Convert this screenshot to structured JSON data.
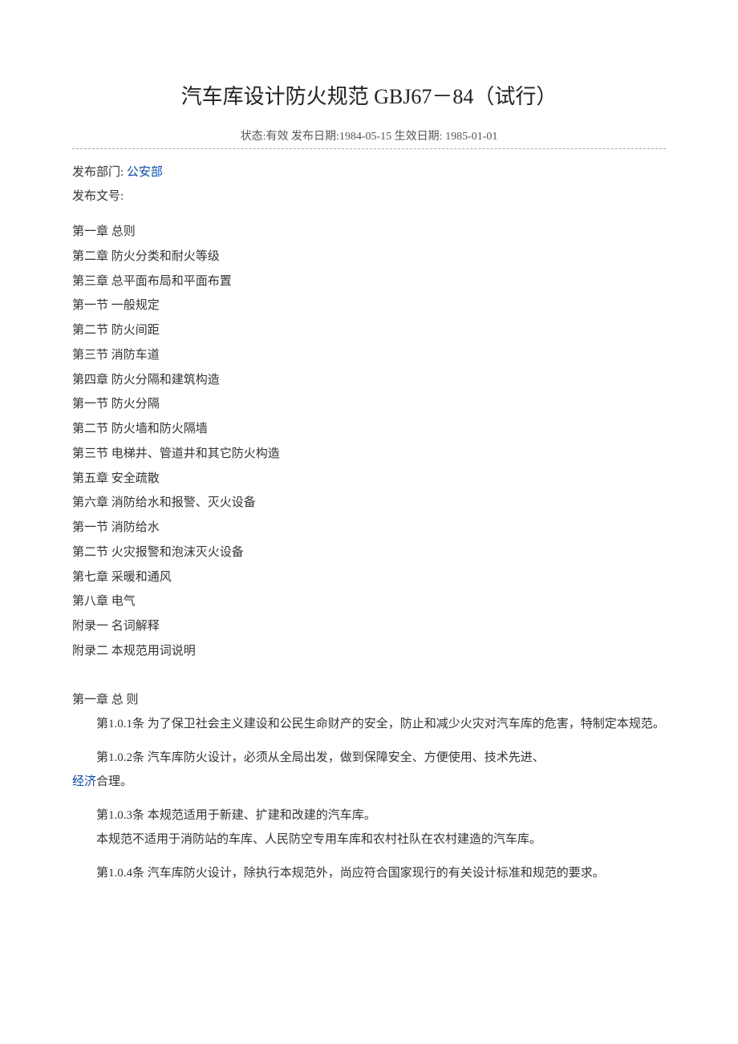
{
  "title": "汽车库设计防火规范 GBJ67－84（试行）",
  "status_line": "状态:有效 发布日期:1984-05-15 生效日期: 1985-01-01",
  "meta": {
    "dept_label": "发布部门: ",
    "dept_value": "公安部",
    "doc_no_label": "发布文号:",
    "doc_no_value": ""
  },
  "toc": [
    "第一章 总则",
    "第二章 防火分类和耐火等级",
    "第三章 总平面布局和平面布置",
    "第一节 一般规定",
    "第二节 防火间距",
    "第三节 消防车道",
    "第四章 防火分隔和建筑构造",
    "第一节 防火分隔",
    "第二节 防火墙和防火隔墙",
    "第三节 电梯井、管道井和其它防火构造",
    "第五章 安全疏散",
    "第六章 消防给水和报警、灭火设备",
    "第一节 消防给水",
    "第二节 火灾报警和泡沫灭火设备",
    "第七章 采暖和通风",
    "第八章 电气",
    "附录一 名词解释",
    "附录二 本规范用词说明"
  ],
  "chapter1": {
    "heading": "第一章 总 则",
    "a1": "第1.0.1条 为了保卫社会主义建设和公民生命财产的安全，防止和减少火灾对汽车库的危害，特制定本规范。",
    "a2_pre": "第1.0.2条 汽车库防火设计，必须从全局出发，做到保障安全、方便使用、技术先进、",
    "a2_link": "经济",
    "a2_post": "合理。",
    "a3_l1": "第1.0.3条 本规范适用于新建、扩建和改建的汽车库。",
    "a3_l2": "本规范不适用于消防站的车库、人民防空专用车库和农村社队在农村建造的汽车库。",
    "a4": "第1.0.4条 汽车库防火设计，除执行本规范外，尚应符合国家现行的有关设计标准和规范的要求。"
  }
}
